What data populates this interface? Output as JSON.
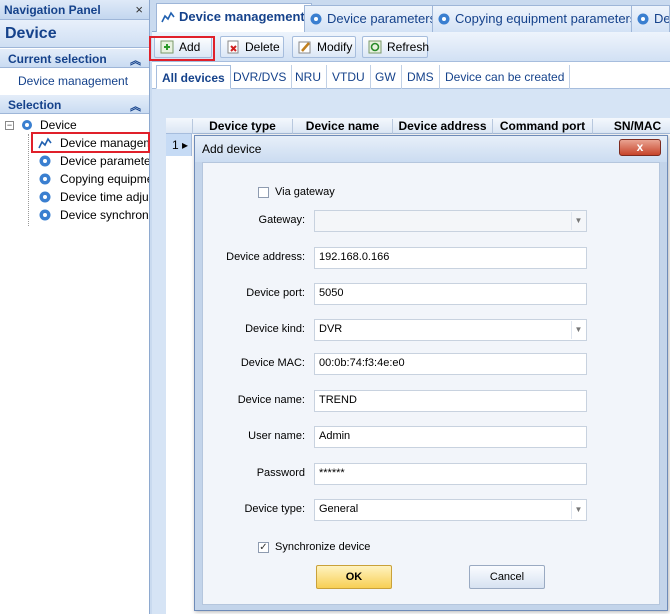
{
  "nav": {
    "header": "Navigation Panel",
    "close": "×",
    "title": "Device",
    "current_selection": "Current selection",
    "current_item": "Device management",
    "selection": "Selection",
    "chevron": "︽",
    "tree_root": "Device",
    "tree_expander": "−",
    "tree_items": [
      {
        "label": "Device management",
        "icon": "device-management-icon"
      },
      {
        "label": "Device parameters",
        "icon": "gear-icon"
      },
      {
        "label": "Copying equipment parameters",
        "icon": "gear-icon"
      },
      {
        "label": "Device time adjustment",
        "icon": "gear-icon"
      },
      {
        "label": "Device synchronization",
        "icon": "gear-icon"
      }
    ]
  },
  "tabs": [
    {
      "label": "Device management",
      "icon": "device-management-icon"
    },
    {
      "label": "Device parameters",
      "icon": "gear-icon"
    },
    {
      "label": "Copying equipment parameters",
      "icon": "gear-icon"
    },
    {
      "label": "Device",
      "icon": "gear-icon"
    }
  ],
  "toolbar": {
    "add": "Add",
    "delete": "Delete",
    "modify": "Modify",
    "refresh": "Refresh"
  },
  "subtabs": [
    "All devices",
    "DVR/DVS",
    "NRU",
    "VTDU",
    "GW",
    "DMS",
    "Device can be created"
  ],
  "grid": {
    "columns": [
      "Device type",
      "Device name",
      "Device address",
      "Command port",
      "SN/MAC"
    ],
    "row_number": "1",
    "row_marker": "▸"
  },
  "dialog": {
    "title": "Add device",
    "close": "x",
    "via_gateway_label": "Via gateway",
    "via_gateway_checked": false,
    "gateway_label": "Gateway:",
    "gateway_value": "",
    "device_address_label": "Device address:",
    "device_address_value": "192.168.0.166",
    "device_port_label": "Device port:",
    "device_port_value": "5050",
    "device_kind_label": "Device kind:",
    "device_kind_value": "DVR",
    "device_mac_label": "Device MAC:",
    "device_mac_value": "00:0b:74:f3:4e:e0",
    "device_name_label": "Device name:",
    "device_name_value": "TREND",
    "user_name_label": "User name:",
    "user_name_value": "Admin",
    "password_label": "Password",
    "password_value": "******",
    "device_type_label": "Device type:",
    "device_type_value": "General",
    "sync_label": "Synchronize device",
    "sync_checked": true,
    "check_mark": "✓",
    "dropdown_arrow": "▼",
    "ok": "OK",
    "cancel": "Cancel"
  },
  "colors": {
    "highlight": "#e0202a",
    "nav_text": "#15428b",
    "ok_button": "#f7cf55"
  }
}
